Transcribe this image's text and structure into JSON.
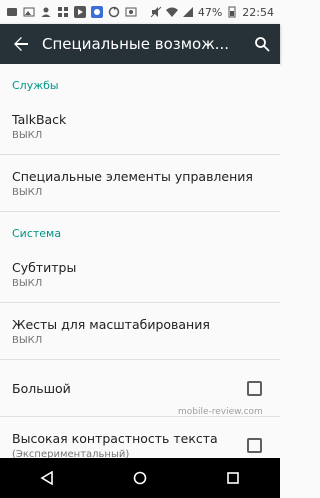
{
  "statusbar": {
    "battery": "47%",
    "time": "22:54"
  },
  "appbar": {
    "title": "Специальные возмож..."
  },
  "sections": {
    "services": {
      "label": "Службы"
    },
    "system": {
      "label": "Система"
    }
  },
  "items": {
    "talkback": {
      "title": "TalkBack",
      "summary": "ВЫКЛ"
    },
    "switch_access": {
      "title": "Специальные элементы управления",
      "summary": "ВЫКЛ"
    },
    "captions": {
      "title": "Субтитры",
      "summary": "ВЫКЛ"
    },
    "magnification": {
      "title": "Жесты для масштабирования",
      "summary": "ВЫКЛ"
    },
    "large_text": {
      "title": "Большой",
      "checked": false
    },
    "high_contrast": {
      "title": "Высокая контрастность текста",
      "summary": "(Экспериментальный)",
      "checked": false
    }
  },
  "watermark": "mobile-review.com",
  "colors": {
    "appbar": "#263238",
    "accent": "#009688",
    "navbar": "#000000"
  }
}
